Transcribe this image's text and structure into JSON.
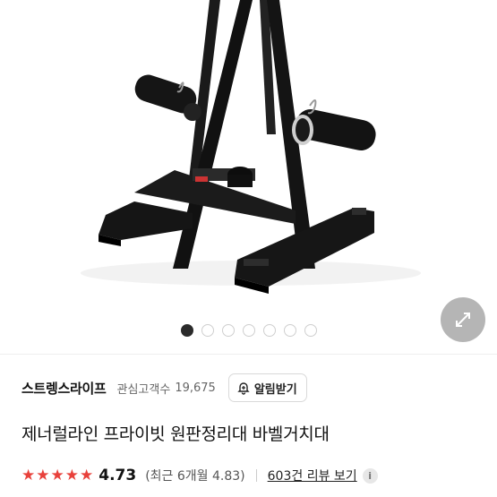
{
  "gallery": {
    "image_count": 7,
    "active_index": 0,
    "expand_icon": "expand-arrows-icon"
  },
  "seller": {
    "name": "스트렝스라이프",
    "follower_label": "관심고객수",
    "follower_count": "19,675",
    "alert_button_label": "알림받기",
    "alert_icon": "bell-plus-icon"
  },
  "product": {
    "title": "제너럴라인 프라이빗 원판정리대 바벨거치대"
  },
  "rating": {
    "stars": 5,
    "value": "4.73",
    "recent_text": "(최근 6개월 4.83)",
    "review_link": "603건 리뷰 보기",
    "info_icon": "info-icon",
    "star_color": "#e8413b"
  }
}
